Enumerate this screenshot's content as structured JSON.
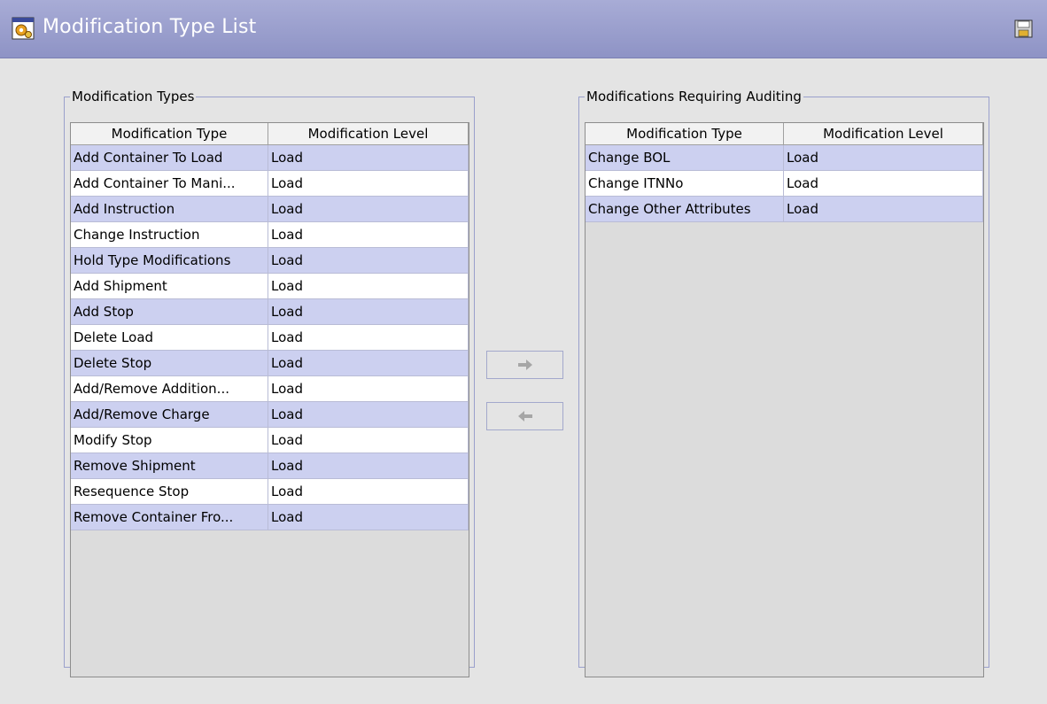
{
  "window": {
    "title": "Modification Type List",
    "icons": {
      "app": "gear-window-icon",
      "save": "save-icon"
    }
  },
  "left_panel": {
    "legend": "Modification Types",
    "columns": [
      "Modification Type",
      "Modification Level"
    ],
    "rows": [
      [
        "Add Container To Load",
        "Load"
      ],
      [
        "Add Container To Mani...",
        "Load"
      ],
      [
        "Add Instruction",
        "Load"
      ],
      [
        "Change Instruction",
        "Load"
      ],
      [
        "Hold Type Modifications",
        "Load"
      ],
      [
        "Add Shipment",
        "Load"
      ],
      [
        "Add Stop",
        "Load"
      ],
      [
        "Delete Load",
        "Load"
      ],
      [
        "Delete Stop",
        "Load"
      ],
      [
        "Add/Remove Addition...",
        "Load"
      ],
      [
        "Add/Remove Charge",
        "Load"
      ],
      [
        "Modify Stop",
        "Load"
      ],
      [
        "Remove Shipment",
        "Load"
      ],
      [
        "Resequence Stop",
        "Load"
      ],
      [
        "Remove Container Fro...",
        "Load"
      ]
    ]
  },
  "right_panel": {
    "legend": "Modifications Requiring Auditing",
    "columns": [
      "Modification Type",
      "Modification Level"
    ],
    "rows": [
      [
        "Change BOL",
        "Load"
      ],
      [
        "Change ITNNo",
        "Load"
      ],
      [
        "Change Other Attributes",
        "Load"
      ]
    ]
  },
  "buttons": {
    "move_right_icon": "arrow-right-icon",
    "move_left_icon": "arrow-left-icon"
  },
  "colors": {
    "titlebar": "#9a9ecf",
    "row_alt": "#ccd0f0",
    "row": "#ffffff",
    "background": "#e4e4e4"
  }
}
